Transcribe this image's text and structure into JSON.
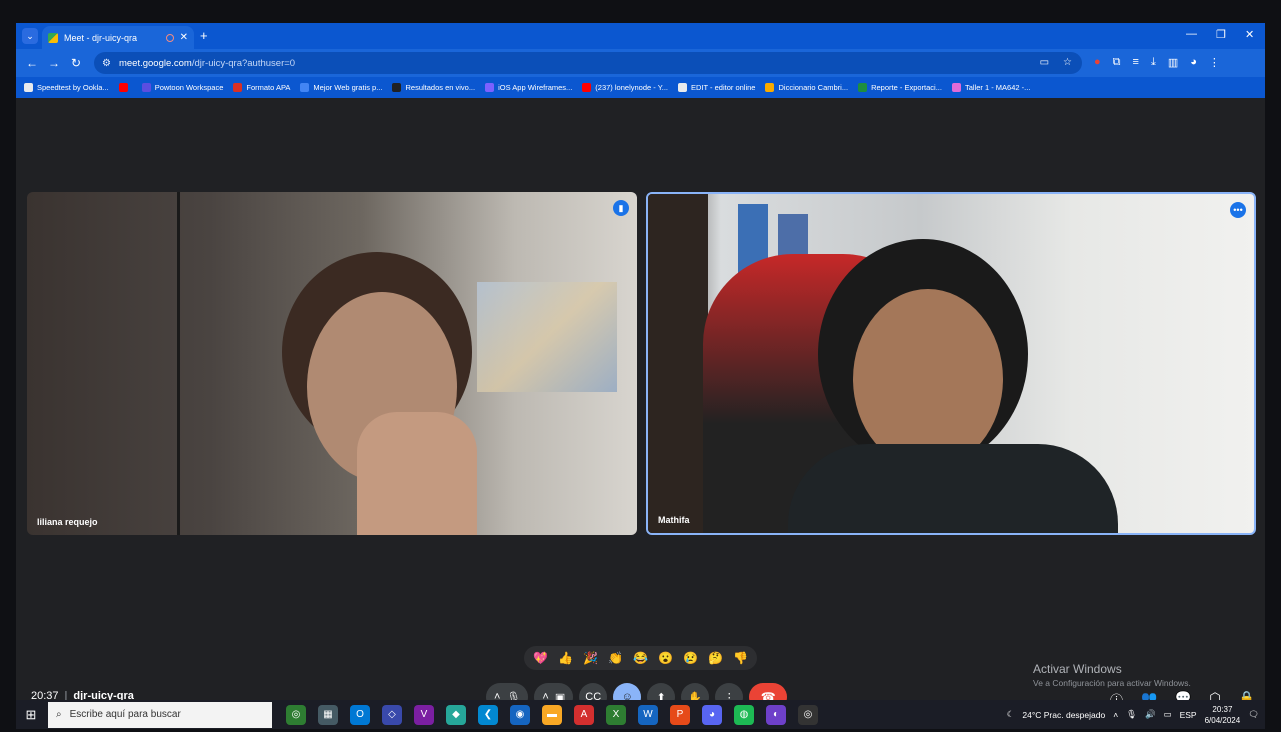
{
  "browser": {
    "tab_title": "Meet - djr-uicy-qra",
    "url_host": "meet.google.com",
    "url_path": "/djr-uicy-qra?authuser=0"
  },
  "bookmarks": [
    {
      "label": "Speedtest by Ookla...",
      "color": "#e8eaed"
    },
    {
      "label": "",
      "color": "#ff0000"
    },
    {
      "label": "Powtoon Workspace",
      "color": "#5b4ee0"
    },
    {
      "label": "Formato APA",
      "color": "#d93025"
    },
    {
      "label": "Mejor Web gratis p...",
      "color": "#4285f4"
    },
    {
      "label": "Resultados en vivo...",
      "color": "#202124"
    },
    {
      "label": "iOS App Wireframes...",
      "color": "#7b61ff"
    },
    {
      "label": "(237) lonelynode - Y...",
      "color": "#ff0000"
    },
    {
      "label": "EDIT - editor online",
      "color": "#e8eaed"
    },
    {
      "label": "Diccionario Cambri...",
      "color": "#f9ab00"
    },
    {
      "label": "Reporte - Exportaci...",
      "color": "#1e8e3e"
    },
    {
      "label": "Taller 1 - MA642 -...",
      "color": "#e06bd8"
    }
  ],
  "participants": [
    {
      "name": "liliana requejo"
    },
    {
      "name": "Mathifa"
    }
  ],
  "reactions": [
    "💖",
    "👍",
    "🎉",
    "👏",
    "😂",
    "😮",
    "😢",
    "🤔",
    "👎"
  ],
  "meeting": {
    "time": "20:37",
    "separator": "|",
    "code": "djr-uicy-qra"
  },
  "watermark": {
    "line1": "Activar Windows",
    "line2": "Ve a Configuración para activar Windows."
  },
  "taskbar": {
    "search_placeholder": "Escribe aquí para buscar",
    "weather": "24°C  Prac. despejado",
    "lang": "ESP",
    "clock_time": "20:37",
    "clock_date": "6/04/2024"
  },
  "colors": {
    "accent": "#0b57d0",
    "leave": "#ea4335",
    "active_speaker": "#8ab4f8"
  }
}
